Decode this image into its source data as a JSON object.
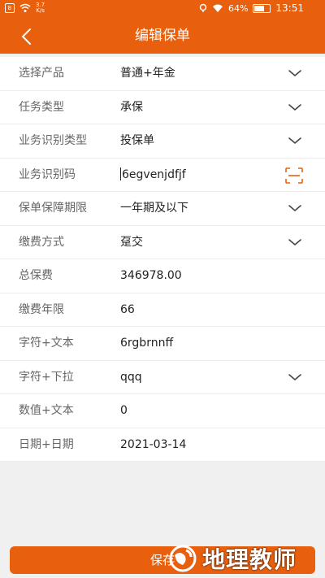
{
  "status_bar": {
    "net_speed_value": "3.7",
    "net_speed_unit": "K/s",
    "battery": "64%",
    "battery_level": 0.64,
    "time": "13:51"
  },
  "header": {
    "title": "编辑保单"
  },
  "form": {
    "rows": [
      {
        "label": "选择产品",
        "value": "普通+年金",
        "type": "dropdown"
      },
      {
        "label": "任务类型",
        "value": "承保",
        "type": "dropdown"
      },
      {
        "label": "业务识别类型",
        "value": "投保单",
        "type": "dropdown"
      },
      {
        "label": "业务识别码",
        "value": "6egvenjdfjf",
        "type": "scan-input"
      },
      {
        "label": "保单保障期限",
        "value": "一年期及以下",
        "type": "dropdown"
      },
      {
        "label": "缴费方式",
        "value": "趸交",
        "type": "dropdown"
      },
      {
        "label": "总保费",
        "value": "346978.00",
        "type": "input"
      },
      {
        "label": "缴费年限",
        "value": "66",
        "type": "input"
      },
      {
        "label": "字符+文本",
        "value": "6rgbrnnff",
        "type": "input"
      },
      {
        "label": "字符+下拉",
        "value": "qqq",
        "type": "dropdown"
      },
      {
        "label": "数值+文本",
        "value": "0",
        "type": "input"
      },
      {
        "label": "日期+日期",
        "value": "2021-03-14",
        "type": "date"
      }
    ]
  },
  "footer": {
    "save_label": "保存"
  },
  "watermark": {
    "text": "地理教师"
  },
  "colors": {
    "brand": "#e8600e",
    "background": "#f0f0f0",
    "label": "#666666",
    "value": "#222222"
  }
}
